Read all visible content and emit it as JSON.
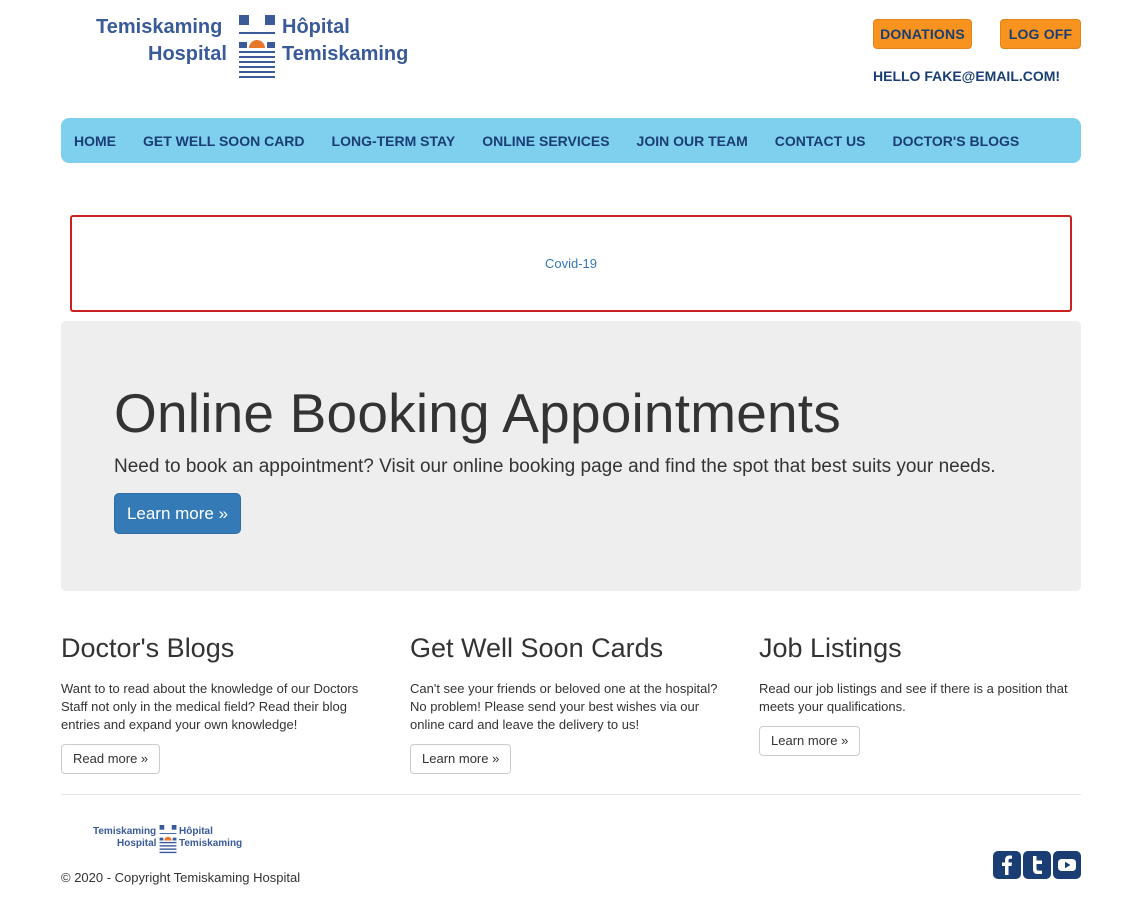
{
  "logo": {
    "line1_left": "Temiskaming",
    "line2_left": "Hospital",
    "line1_right": "Hôpital",
    "line2_right": "Temiskaming"
  },
  "header": {
    "donations_label": "DONATIONS",
    "logoff_label": "LOG OFF",
    "greeting": "HELLO FAKE@EMAIL.COM!"
  },
  "nav": {
    "items": [
      {
        "label": "HOME"
      },
      {
        "label": "GET WELL SOON CARD"
      },
      {
        "label": "LONG-TERM STAY"
      },
      {
        "label": "ONLINE SERVICES"
      },
      {
        "label": "JOIN OUR TEAM"
      },
      {
        "label": "CONTACT US"
      },
      {
        "label": "DOCTOR'S BLOGS"
      }
    ]
  },
  "alert": {
    "link_text": "Covid-19"
  },
  "hero": {
    "title": "Online Booking Appointments",
    "text": "Need to book an appointment? Visit our online booking page and find the spot that best suits your needs.",
    "button_label": "Learn more »"
  },
  "columns": [
    {
      "title": "Doctor's Blogs",
      "text": "Want to to read about the knowledge of our Doctors Staff not only in the medical field? Read their blog entries and expand your own knowledge!",
      "button_label": "Read more »"
    },
    {
      "title": "Get Well Soon Cards",
      "text": "Can't see your friends or beloved one at the hospital? No problem! Please send your best wishes via our online card and leave the delivery to us!",
      "button_label": "Learn more »"
    },
    {
      "title": "Job Listings",
      "text": "Read our job listings and see if there is a position that meets your qualifications.",
      "button_label": "Learn more »"
    }
  ],
  "footer": {
    "copyright": "© 2020 - Copyright Temiskaming Hospital",
    "social": [
      "facebook-icon",
      "twitter-icon",
      "youtube-icon"
    ]
  },
  "colors": {
    "nav_bg": "#7fcfef",
    "brand_dark": "#1a3e73",
    "accent_orange": "#f7931e",
    "primary_blue": "#337ab7",
    "alert_border": "#cc1f1f"
  }
}
